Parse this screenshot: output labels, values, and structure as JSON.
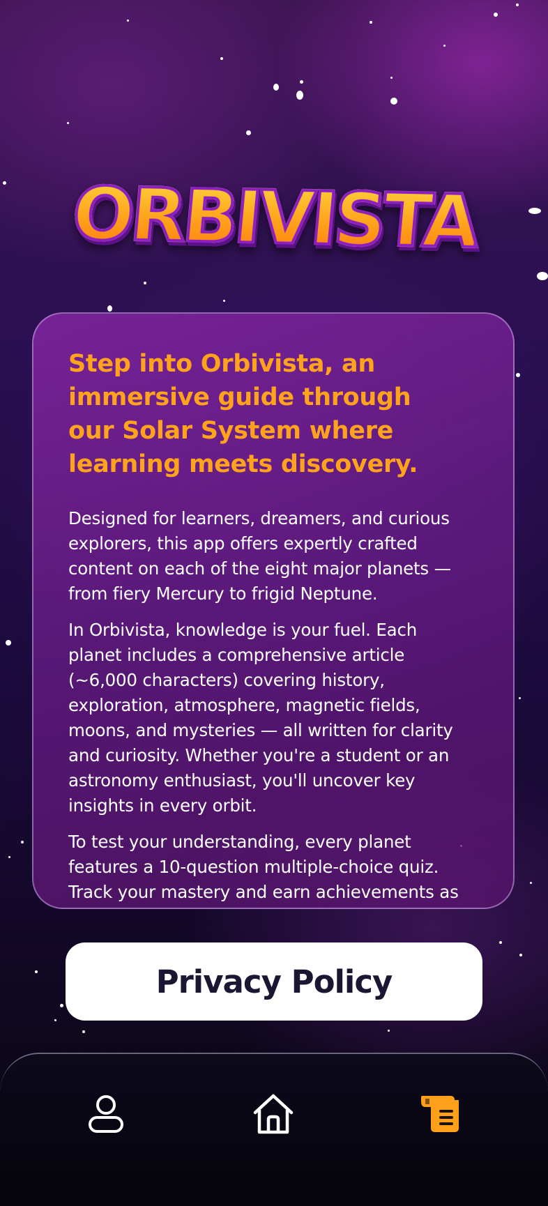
{
  "app": {
    "logo_text": "ORBIVISTA"
  },
  "about": {
    "headline": "Step into Orbivista, an immersive guide through our Solar System where learning meets discovery.",
    "paragraphs": [
      "Designed for learners, dreamers, and curious explorers, this app offers expertly crafted content on each of the eight major planets — from fiery Mercury to frigid Neptune.",
      "In Orbivista, knowledge is your fuel. Each planet includes a comprehensive article (~6,000 characters) covering history, exploration, atmosphere, magnetic fields, moons, and mysteries — all written for clarity and curiosity. Whether you're a student or an astronomy enthusiast, you'll uncover key insights in every orbit.",
      "To test your understanding, every planet features a 10-question multiple-choice quiz. Track your mastery and earn achievements as"
    ]
  },
  "actions": {
    "privacy_label": "Privacy Policy"
  },
  "tabbar": {
    "items": [
      {
        "icon": "profile-icon",
        "active": false
      },
      {
        "icon": "home-icon",
        "active": false
      },
      {
        "icon": "about-scroll-icon",
        "active": true
      }
    ]
  },
  "colors": {
    "accent": "#ffa21c",
    "logo_outline": "#8d1fc2",
    "button_text": "#1a1733",
    "tab_inactive": "#ffffff",
    "tab_active": "#ff9f1a"
  }
}
